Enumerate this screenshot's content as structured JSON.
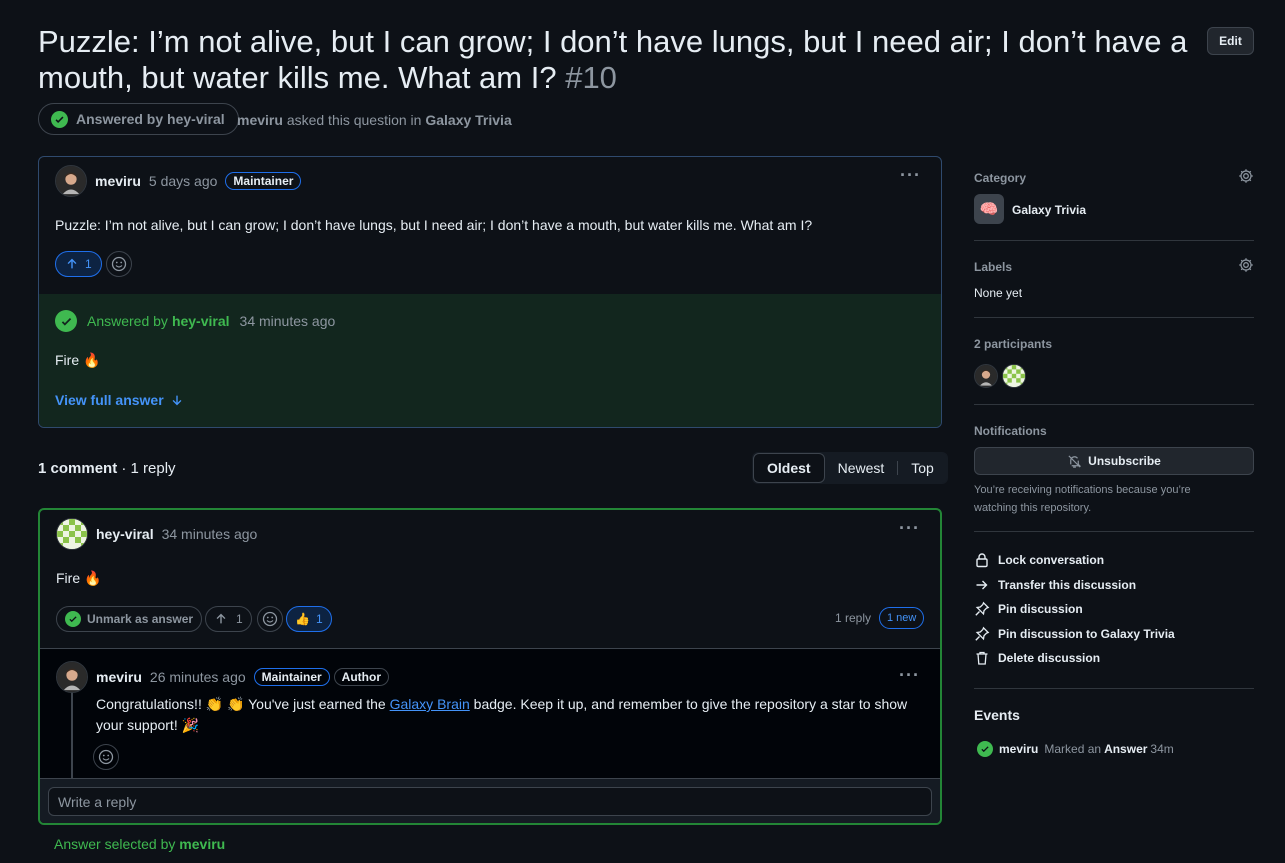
{
  "header": {
    "title": "Puzzle: I’m not alive, but I can grow; I don’t have lungs, but I need air; I don’t have a mouth, but water kills me. What am I?",
    "number": "#10",
    "edit_label": "Edit",
    "answered_pill": "Answered by hey-viral",
    "asker": "meviru",
    "asked_text": "asked this question in",
    "category": "Galaxy Trivia"
  },
  "question": {
    "author": "meviru",
    "time": "5 days ago",
    "badge": "Maintainer",
    "body": "Puzzle: I’m not alive, but I can grow; I don’t have lungs, but I need air; I don’t have a mouth, but water kills me. What am I?",
    "upvotes": "1",
    "answer": {
      "prefix": "Answered by",
      "author": "hey-viral",
      "time": "34 minutes ago",
      "text": "Fire 🔥",
      "view_full": "View full answer"
    }
  },
  "comments": {
    "count": "1 comment",
    "replies": "· 1 reply",
    "sort_options": [
      "Oldest",
      "Newest",
      "Top"
    ],
    "selected_sort": "Oldest"
  },
  "answer_comment": {
    "author": "hey-viral",
    "time": "34 minutes ago",
    "body": "Fire 🔥",
    "unmark_label": "Unmark as answer",
    "upvotes": "1",
    "thumbs_count": "1",
    "reply_count": "1 reply",
    "new_count": "1 new",
    "reply": {
      "author": "meviru",
      "time": "26 minutes ago",
      "badges": [
        "Maintainer",
        "Author"
      ],
      "body_before": "Congratulations!! 👏 👏 You've just earned the",
      "link": "Galaxy Brain",
      "body_after": "badge. Keep it up, and remember to give the repository a star to show your support! 🎉"
    },
    "write_reply_placeholder": "Write a reply"
  },
  "answer_selected": {
    "prefix": "Answer selected by",
    "author": "meviru"
  },
  "sidebar": {
    "category_label": "Category",
    "category_value": "Galaxy Trivia",
    "category_emoji": "🧠",
    "labels_label": "Labels",
    "labels_value": "None yet",
    "participants_label": "2 participants",
    "notifications_label": "Notifications",
    "unsubscribe_label": "Unsubscribe",
    "notifications_text": "You’re receiving notifications because you’re watching this repository.",
    "actions": [
      "Lock conversation",
      "Transfer this discussion",
      "Pin discussion",
      "Pin discussion to Galaxy Trivia",
      "Delete discussion"
    ],
    "events_title": "Events",
    "event": {
      "user": "meviru",
      "action": "Marked an",
      "target": "Answer",
      "time": "34m"
    }
  },
  "colors": {
    "accent_blue": "#4493f8",
    "success_green": "#3fb950",
    "bg": "#0d1117"
  }
}
